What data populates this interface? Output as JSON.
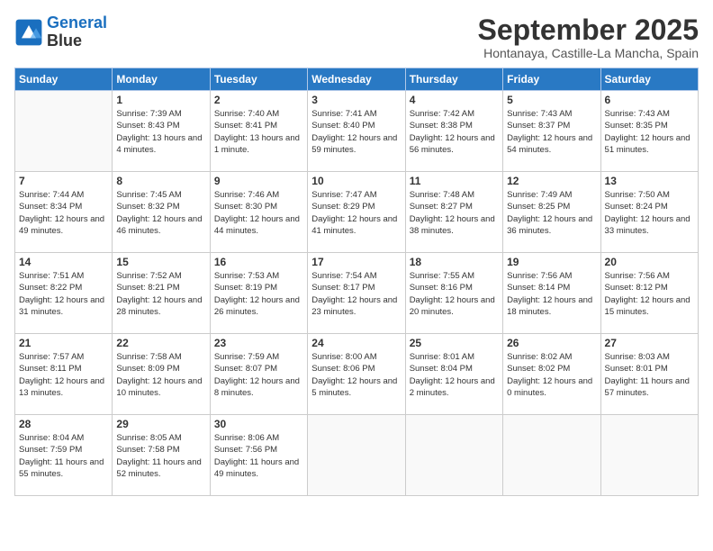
{
  "header": {
    "logo_line1": "General",
    "logo_line2": "Blue",
    "month_title": "September 2025",
    "location": "Hontanaya, Castille-La Mancha, Spain"
  },
  "weekdays": [
    "Sunday",
    "Monday",
    "Tuesday",
    "Wednesday",
    "Thursday",
    "Friday",
    "Saturday"
  ],
  "weeks": [
    [
      {
        "day": "",
        "sunrise": "",
        "sunset": "",
        "daylight": ""
      },
      {
        "day": "1",
        "sunrise": "Sunrise: 7:39 AM",
        "sunset": "Sunset: 8:43 PM",
        "daylight": "Daylight: 13 hours and 4 minutes."
      },
      {
        "day": "2",
        "sunrise": "Sunrise: 7:40 AM",
        "sunset": "Sunset: 8:41 PM",
        "daylight": "Daylight: 13 hours and 1 minute."
      },
      {
        "day": "3",
        "sunrise": "Sunrise: 7:41 AM",
        "sunset": "Sunset: 8:40 PM",
        "daylight": "Daylight: 12 hours and 59 minutes."
      },
      {
        "day": "4",
        "sunrise": "Sunrise: 7:42 AM",
        "sunset": "Sunset: 8:38 PM",
        "daylight": "Daylight: 12 hours and 56 minutes."
      },
      {
        "day": "5",
        "sunrise": "Sunrise: 7:43 AM",
        "sunset": "Sunset: 8:37 PM",
        "daylight": "Daylight: 12 hours and 54 minutes."
      },
      {
        "day": "6",
        "sunrise": "Sunrise: 7:43 AM",
        "sunset": "Sunset: 8:35 PM",
        "daylight": "Daylight: 12 hours and 51 minutes."
      }
    ],
    [
      {
        "day": "7",
        "sunrise": "Sunrise: 7:44 AM",
        "sunset": "Sunset: 8:34 PM",
        "daylight": "Daylight: 12 hours and 49 minutes."
      },
      {
        "day": "8",
        "sunrise": "Sunrise: 7:45 AM",
        "sunset": "Sunset: 8:32 PM",
        "daylight": "Daylight: 12 hours and 46 minutes."
      },
      {
        "day": "9",
        "sunrise": "Sunrise: 7:46 AM",
        "sunset": "Sunset: 8:30 PM",
        "daylight": "Daylight: 12 hours and 44 minutes."
      },
      {
        "day": "10",
        "sunrise": "Sunrise: 7:47 AM",
        "sunset": "Sunset: 8:29 PM",
        "daylight": "Daylight: 12 hours and 41 minutes."
      },
      {
        "day": "11",
        "sunrise": "Sunrise: 7:48 AM",
        "sunset": "Sunset: 8:27 PM",
        "daylight": "Daylight: 12 hours and 38 minutes."
      },
      {
        "day": "12",
        "sunrise": "Sunrise: 7:49 AM",
        "sunset": "Sunset: 8:25 PM",
        "daylight": "Daylight: 12 hours and 36 minutes."
      },
      {
        "day": "13",
        "sunrise": "Sunrise: 7:50 AM",
        "sunset": "Sunset: 8:24 PM",
        "daylight": "Daylight: 12 hours and 33 minutes."
      }
    ],
    [
      {
        "day": "14",
        "sunrise": "Sunrise: 7:51 AM",
        "sunset": "Sunset: 8:22 PM",
        "daylight": "Daylight: 12 hours and 31 minutes."
      },
      {
        "day": "15",
        "sunrise": "Sunrise: 7:52 AM",
        "sunset": "Sunset: 8:21 PM",
        "daylight": "Daylight: 12 hours and 28 minutes."
      },
      {
        "day": "16",
        "sunrise": "Sunrise: 7:53 AM",
        "sunset": "Sunset: 8:19 PM",
        "daylight": "Daylight: 12 hours and 26 minutes."
      },
      {
        "day": "17",
        "sunrise": "Sunrise: 7:54 AM",
        "sunset": "Sunset: 8:17 PM",
        "daylight": "Daylight: 12 hours and 23 minutes."
      },
      {
        "day": "18",
        "sunrise": "Sunrise: 7:55 AM",
        "sunset": "Sunset: 8:16 PM",
        "daylight": "Daylight: 12 hours and 20 minutes."
      },
      {
        "day": "19",
        "sunrise": "Sunrise: 7:56 AM",
        "sunset": "Sunset: 8:14 PM",
        "daylight": "Daylight: 12 hours and 18 minutes."
      },
      {
        "day": "20",
        "sunrise": "Sunrise: 7:56 AM",
        "sunset": "Sunset: 8:12 PM",
        "daylight": "Daylight: 12 hours and 15 minutes."
      }
    ],
    [
      {
        "day": "21",
        "sunrise": "Sunrise: 7:57 AM",
        "sunset": "Sunset: 8:11 PM",
        "daylight": "Daylight: 12 hours and 13 minutes."
      },
      {
        "day": "22",
        "sunrise": "Sunrise: 7:58 AM",
        "sunset": "Sunset: 8:09 PM",
        "daylight": "Daylight: 12 hours and 10 minutes."
      },
      {
        "day": "23",
        "sunrise": "Sunrise: 7:59 AM",
        "sunset": "Sunset: 8:07 PM",
        "daylight": "Daylight: 12 hours and 8 minutes."
      },
      {
        "day": "24",
        "sunrise": "Sunrise: 8:00 AM",
        "sunset": "Sunset: 8:06 PM",
        "daylight": "Daylight: 12 hours and 5 minutes."
      },
      {
        "day": "25",
        "sunrise": "Sunrise: 8:01 AM",
        "sunset": "Sunset: 8:04 PM",
        "daylight": "Daylight: 12 hours and 2 minutes."
      },
      {
        "day": "26",
        "sunrise": "Sunrise: 8:02 AM",
        "sunset": "Sunset: 8:02 PM",
        "daylight": "Daylight: 12 hours and 0 minutes."
      },
      {
        "day": "27",
        "sunrise": "Sunrise: 8:03 AM",
        "sunset": "Sunset: 8:01 PM",
        "daylight": "Daylight: 11 hours and 57 minutes."
      }
    ],
    [
      {
        "day": "28",
        "sunrise": "Sunrise: 8:04 AM",
        "sunset": "Sunset: 7:59 PM",
        "daylight": "Daylight: 11 hours and 55 minutes."
      },
      {
        "day": "29",
        "sunrise": "Sunrise: 8:05 AM",
        "sunset": "Sunset: 7:58 PM",
        "daylight": "Daylight: 11 hours and 52 minutes."
      },
      {
        "day": "30",
        "sunrise": "Sunrise: 8:06 AM",
        "sunset": "Sunset: 7:56 PM",
        "daylight": "Daylight: 11 hours and 49 minutes."
      },
      {
        "day": "",
        "sunrise": "",
        "sunset": "",
        "daylight": ""
      },
      {
        "day": "",
        "sunrise": "",
        "sunset": "",
        "daylight": ""
      },
      {
        "day": "",
        "sunrise": "",
        "sunset": "",
        "daylight": ""
      },
      {
        "day": "",
        "sunrise": "",
        "sunset": "",
        "daylight": ""
      }
    ]
  ]
}
